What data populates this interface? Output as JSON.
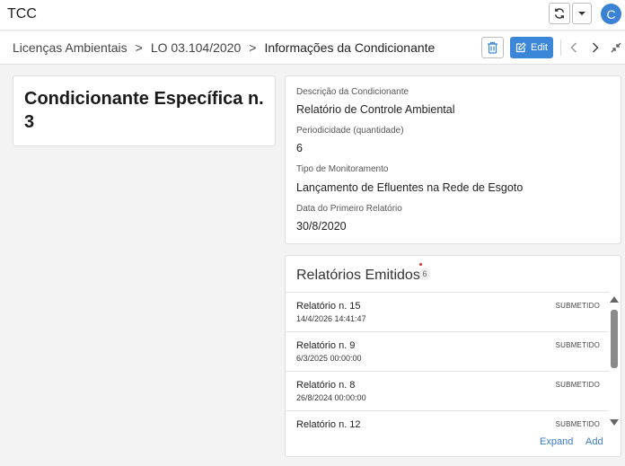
{
  "app": {
    "title": "TCC",
    "avatar_letter": "C"
  },
  "breadcrumb": {
    "items": [
      "Licenças Ambientais",
      "LO 03.104/2020"
    ],
    "current": "Informações da Condicionante",
    "separator": ">"
  },
  "toolbar": {
    "edit_label": "Edit"
  },
  "record": {
    "title": "Condicionante Específica n. 3"
  },
  "details": {
    "fields": [
      {
        "label": "Descrição da Condicionante",
        "value": "Relatório de Controle Ambiental"
      },
      {
        "label": "Periodicidade (quantidade)",
        "value": "6"
      },
      {
        "label": "Tipo de Monitoramento",
        "value": "Lançamento de Efluentes na Rede de Esgoto"
      },
      {
        "label": "Data do Primeiro Relatório",
        "value": "30/8/2020"
      }
    ]
  },
  "reports": {
    "title": "Relatórios Emitidos",
    "count": "6",
    "items": [
      {
        "name": "Relatório n. 15",
        "date": "14/4/2026 14:41:47",
        "status": "SUBMETIDO"
      },
      {
        "name": "Relatório n. 9",
        "date": "6/3/2025 00:00:00",
        "status": "SUBMETIDO"
      },
      {
        "name": "Relatório n. 8",
        "date": "26/8/2024 00:00:00",
        "status": "SUBMETIDO"
      },
      {
        "name": "Relatório n. 12",
        "date": "",
        "status": "SUBMETIDO"
      }
    ],
    "expand_label": "Expand",
    "add_label": "Add"
  },
  "colors": {
    "accent": "#3b86d6",
    "avatar": "#3a83d4",
    "link": "#3a7bc8"
  },
  "icons": [
    "sync-icon",
    "chevron-down-icon",
    "trash-icon",
    "edit-icon",
    "chevron-left-icon",
    "chevron-right-icon",
    "collapse-icon"
  ]
}
